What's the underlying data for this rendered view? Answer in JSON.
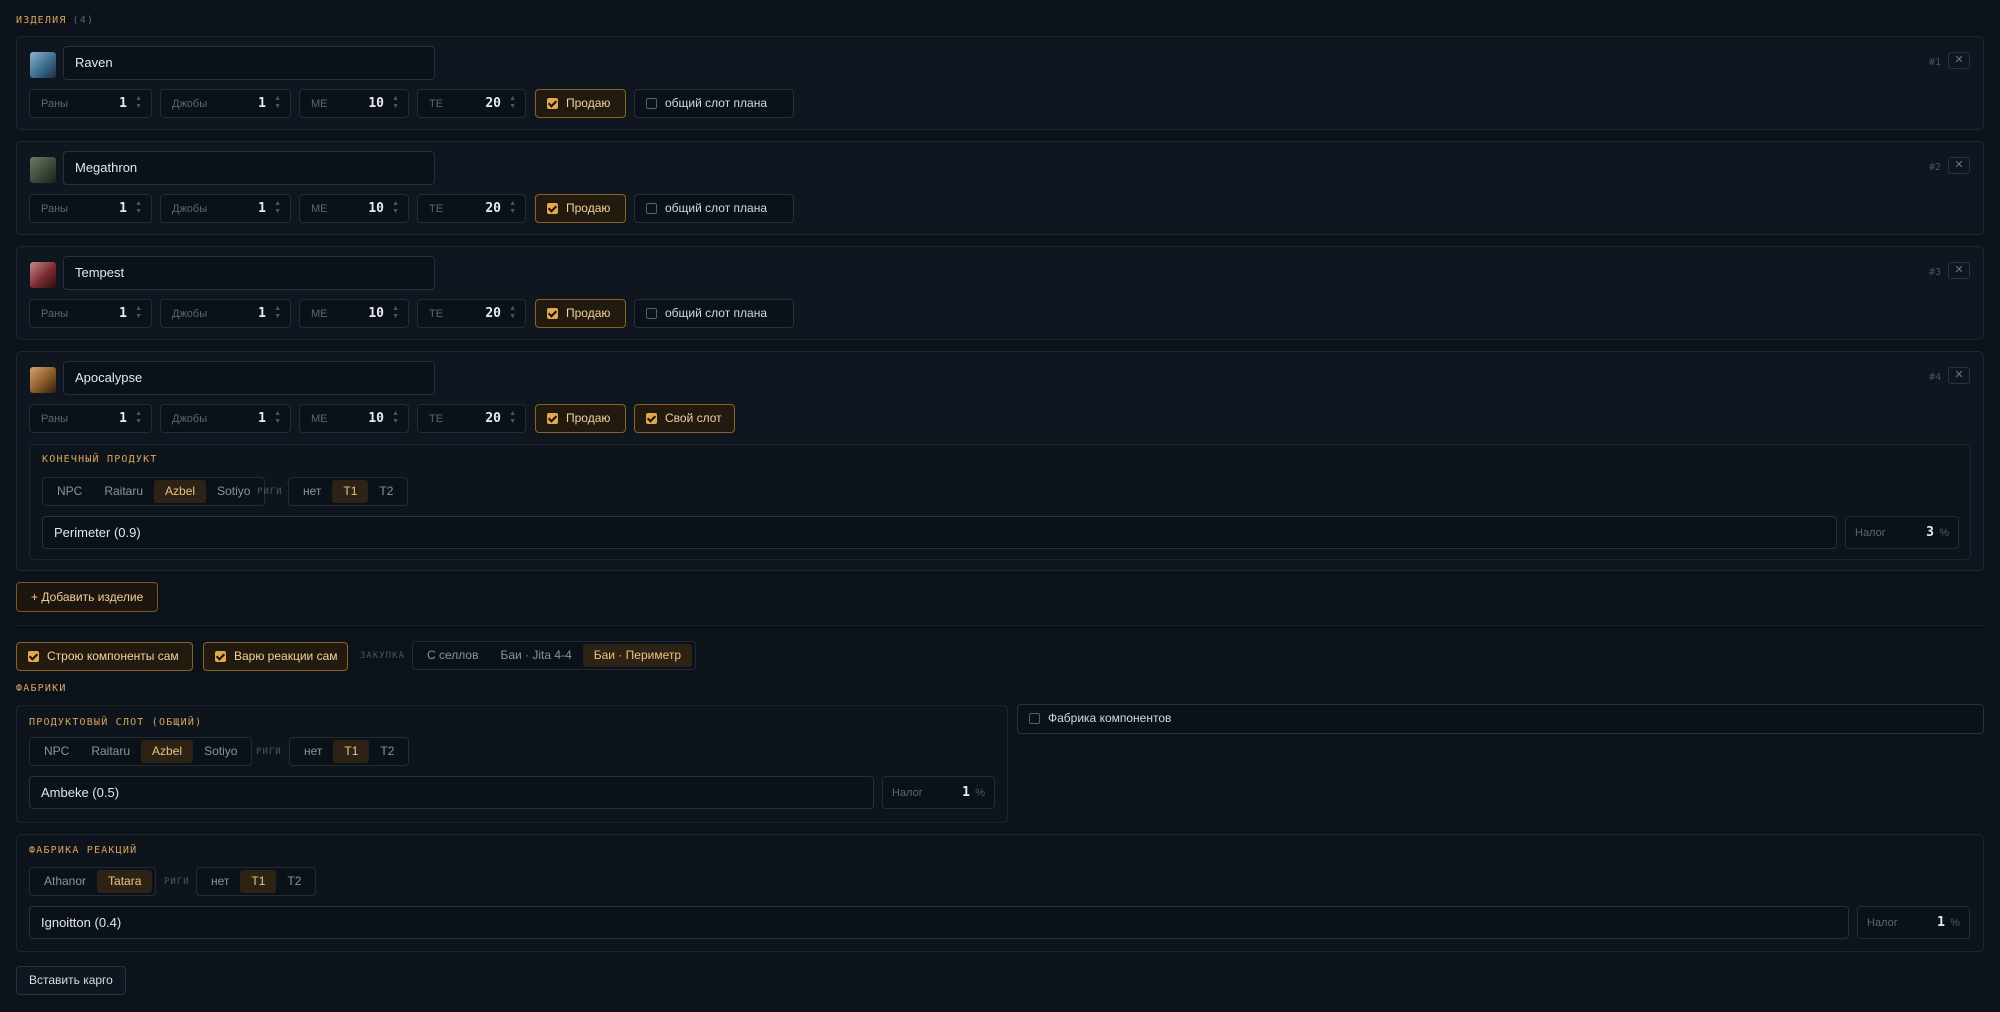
{
  "section_items": {
    "label": "ИЗДЕЛИЯ",
    "count": "(4)"
  },
  "items": [
    {
      "name": "Raven",
      "num": "#1",
      "runs_label": "Раны",
      "runs": "1",
      "jobs_label": "Джобы",
      "jobs": "1",
      "me_label": "ME",
      "me": "10",
      "te_label": "TE",
      "te": "20",
      "sell_label": "Продаю",
      "slot_label": "общий слот плана",
      "thumb_color": "#3a6d8f"
    },
    {
      "name": "Megathron",
      "num": "#2",
      "runs_label": "Раны",
      "runs": "1",
      "jobs_label": "Джобы",
      "jobs": "1",
      "me_label": "ME",
      "me": "10",
      "te_label": "TE",
      "te": "20",
      "sell_label": "Продаю",
      "slot_label": "общий слот плана",
      "thumb_color": "#3c4a3a"
    },
    {
      "name": "Tempest",
      "num": "#3",
      "runs_label": "Раны",
      "runs": "1",
      "jobs_label": "Джобы",
      "jobs": "1",
      "me_label": "ME",
      "me": "10",
      "te_label": "TE",
      "te": "20",
      "sell_label": "Продаю",
      "slot_label": "общий слот плана",
      "thumb_color": "#7a2a2e"
    },
    {
      "name": "Apocalypse",
      "num": "#4",
      "runs_label": "Раны",
      "runs": "1",
      "jobs_label": "Джобы",
      "jobs": "1",
      "me_label": "ME",
      "me": "10",
      "te_label": "TE",
      "te": "20",
      "sell_label": "Продаю",
      "slot_label": "Свой слот",
      "thumb_color": "#8a5a2a"
    }
  ],
  "final_product": {
    "label": "КОНЕЧНЫЙ ПРОДУКТ",
    "structures": [
      "NPC",
      "Raitaru",
      "Azbel",
      "Sotiyo"
    ],
    "selected_structure": "Azbel",
    "rigs_label": "РИГИ",
    "rigs": [
      "нет",
      "T1",
      "T2"
    ],
    "selected_rig": "T1",
    "system": "Perimeter (0.9)",
    "tax_label": "Налог",
    "tax": "3",
    "tax_unit": "%"
  },
  "add_item_label": "+ Добавить изделие",
  "options": {
    "build_components": "Строю компоненты сам",
    "react_self": "Варю реакции сам",
    "purchase_label": "ЗАКУПКА",
    "purchase_options": [
      "С селлов",
      "Баи · Jita 4-4",
      "Баи · Периметр"
    ],
    "purchase_selected": "Баи · Периметр"
  },
  "factories": {
    "label": "ФАБРИКИ",
    "product_slot": {
      "label": "ПРОДУКТОВЫЙ СЛОТ (ОБЩИЙ)",
      "structures": [
        "NPC",
        "Raitaru",
        "Azbel",
        "Sotiyo"
      ],
      "selected_structure": "Azbel",
      "rigs_label": "РИГИ",
      "rigs": [
        "нет",
        "T1",
        "T2"
      ],
      "selected_rig": "T1",
      "system": "Ambeke (0.5)",
      "tax_label": "Налог",
      "tax": "1",
      "tax_unit": "%"
    },
    "component_factory_label": "Фабрика компонентов",
    "reaction_factory": {
      "label": "ФАБРИКА РЕАКЦИЙ",
      "structures": [
        "Athanor",
        "Tatara"
      ],
      "selected_structure": "Tatara",
      "rigs_label": "РИГИ",
      "rigs": [
        "нет",
        "T1",
        "T2"
      ],
      "selected_rig": "T1",
      "system": "Ignoitton (0.4)",
      "tax_label": "Налог",
      "tax": "1",
      "tax_unit": "%"
    }
  },
  "paste_cargo_label": "Вставить карго",
  "colors": {
    "accent": "#e2a64d",
    "background": "#0c121a",
    "card": "#0f161f"
  }
}
